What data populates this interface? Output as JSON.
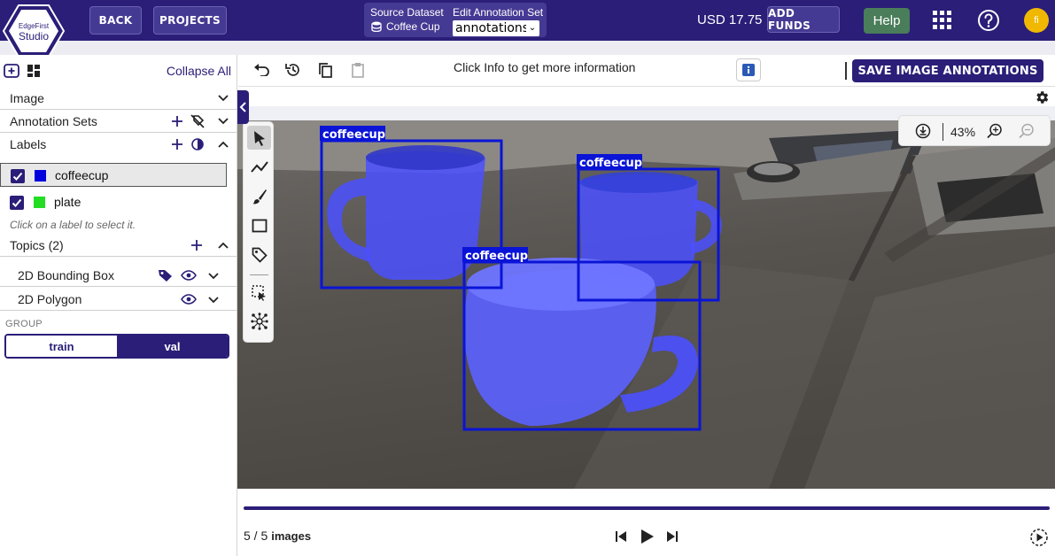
{
  "header": {
    "logo_top": "EdgeFirst",
    "logo_bottom": "Studio",
    "back_label": "BACK",
    "projects_label": "PROJECTS",
    "source_dataset_label": "Source Dataset",
    "source_dataset_value": "Coffee Cup",
    "edit_set_label": "Edit Annotation Set",
    "edit_set_value": "annotations",
    "balance": "USD 17.75",
    "add_funds_label": "ADD FUNDS",
    "help_label": "Help",
    "avatar_initials": "fi"
  },
  "sidebar": {
    "collapse_all": "Collapse All",
    "sections": {
      "image": "Image",
      "annotation_sets": "Annotation Sets",
      "labels": "Labels",
      "topics": "Topics (2)"
    },
    "labels": [
      {
        "name": "coffeecup",
        "color": "#0000dd",
        "checked": true,
        "selected": true
      },
      {
        "name": "plate",
        "color": "#22dd22",
        "checked": true,
        "selected": false
      }
    ],
    "label_hint": "Click on a label to select it.",
    "topics": [
      {
        "name": "2D Bounding Box"
      },
      {
        "name": "2D Polygon"
      }
    ],
    "group_label": "GROUP",
    "group_options": [
      "train",
      "val"
    ],
    "group_selected": "val"
  },
  "toolbar": {
    "info_text": "Click Info to get more information",
    "save_label": "SAVE IMAGE ANNOTATIONS"
  },
  "viewer": {
    "zoom": "43%",
    "annotations": [
      {
        "label": "coffeecup"
      },
      {
        "label": "coffeecup"
      },
      {
        "label": "coffeecup"
      }
    ]
  },
  "footer": {
    "page": "5 / 5",
    "unit": "images",
    "progress_fraction": 1.0
  },
  "colors": {
    "brand": "#2a1e78",
    "help": "#4a7d5a",
    "mask": "#4b50ff",
    "box": "#0a14d6"
  }
}
